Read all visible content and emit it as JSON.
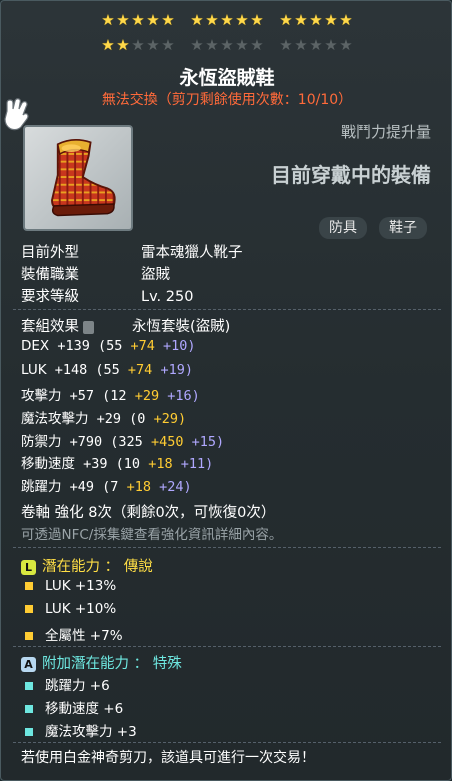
{
  "stars": {
    "row1": [
      5,
      5,
      5
    ],
    "row2_filled": 2,
    "row2": [
      5,
      5,
      5
    ]
  },
  "item": {
    "name": "永恆盜賊鞋",
    "trade_note": "無法交換（剪刀剩餘使用次數：10/10）"
  },
  "combat": {
    "label": "戰鬥力提升量",
    "main": "目前穿戴中的裝備"
  },
  "tags": [
    "防具",
    "鞋子"
  ],
  "info": [
    {
      "label": "目前外型",
      "value": "雷本魂獵人靴子"
    },
    {
      "label": "裝備職業",
      "value": "盜賊"
    },
    {
      "label": "要求等級",
      "value": "Lv. 250"
    }
  ],
  "set": {
    "label": "套組效果",
    "value": "永恆套裝(盜賊)"
  },
  "stats": [
    {
      "name": "DEX",
      "total": "+139",
      "base": "(55",
      "b1": "+74",
      "b2": "+10)"
    },
    {
      "name": "LUK",
      "total": "+148",
      "base": "(55",
      "b1": "+74",
      "b2": "+19)"
    },
    {
      "name": "攻擊力",
      "total": "+57",
      "base": "(12",
      "b1": "+29",
      "b2": "+16)"
    },
    {
      "name": "魔法攻擊力",
      "total": "+29",
      "base": "(0",
      "b1": "+29)",
      "b2": ""
    },
    {
      "name": "防禦力",
      "total": "+790",
      "base": "(325",
      "b1": "+450",
      "b2": "+15)"
    },
    {
      "name": "移動速度",
      "total": "+39",
      "base": "(10",
      "b1": "+18",
      "b2": "+11)"
    },
    {
      "name": "跳躍力",
      "total": "+49",
      "base": "(7",
      "b1": "+18",
      "b2": "+24)"
    }
  ],
  "enhance": {
    "text": "卷軸 強化 8次（剩餘0次，可恢復0次）",
    "hint": "可透過NFC/採集鍵查看強化資訊詳細內容。"
  },
  "potential": {
    "badge": "L",
    "title": "潛在能力 ： 傳說",
    "lines": [
      "LUK +13%",
      "LUK +10%",
      "全屬性 +7%"
    ],
    "color": "#ffde45"
  },
  "additional": {
    "badge": "A",
    "title": "附加潛在能力 ： 特殊",
    "lines": [
      "跳躍力 +6",
      "移動速度 +6",
      "魔法攻擊力 +3"
    ],
    "color": "#6ee7e0"
  },
  "footer": "若使用白金神奇剪刀，該道具可進行一次交易！"
}
